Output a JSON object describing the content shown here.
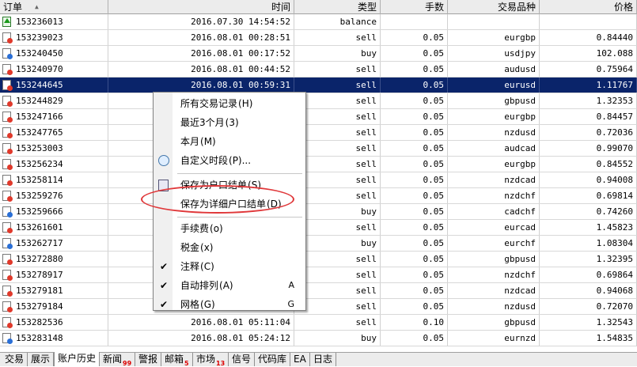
{
  "columns": [
    "订单",
    "时间",
    "类型",
    "手数",
    "交易品种",
    "价格"
  ],
  "rows": [
    {
      "order": "153236013",
      "time": "2016.07.30 14:54:52",
      "type": "balance",
      "lots": "",
      "symbol": "",
      "price": "",
      "icon": "balance"
    },
    {
      "order": "153239023",
      "time": "2016.08.01 00:28:51",
      "type": "sell",
      "lots": "0.05",
      "symbol": "eurgbp",
      "price": "0.84440",
      "icon": "sell"
    },
    {
      "order": "153240450",
      "time": "2016.08.01 00:17:52",
      "type": "buy",
      "lots": "0.05",
      "symbol": "usdjpy",
      "price": "102.088",
      "icon": "buy"
    },
    {
      "order": "153240970",
      "time": "2016.08.01 00:44:52",
      "type": "sell",
      "lots": "0.05",
      "symbol": "audusd",
      "price": "0.75964",
      "icon": "sell"
    },
    {
      "order": "153244645",
      "time": "2016.08.01 00:59:31",
      "type": "sell",
      "lots": "0.05",
      "symbol": "eurusd",
      "price": "1.11767",
      "icon": "sell",
      "selected": true
    },
    {
      "order": "153244829",
      "time": "",
      "type": "sell",
      "lots": "0.05",
      "symbol": "gbpusd",
      "price": "1.32353",
      "icon": "sell"
    },
    {
      "order": "153247166",
      "time": "",
      "type": "sell",
      "lots": "0.05",
      "symbol": "eurgbp",
      "price": "0.84457",
      "icon": "sell"
    },
    {
      "order": "153247765",
      "time": "",
      "type": "sell",
      "lots": "0.05",
      "symbol": "nzdusd",
      "price": "0.72036",
      "icon": "sell"
    },
    {
      "order": "153253003",
      "time": "",
      "type": "sell",
      "lots": "0.05",
      "symbol": "audcad",
      "price": "0.99070",
      "icon": "sell"
    },
    {
      "order": "153256234",
      "time": "",
      "type": "sell",
      "lots": "0.05",
      "symbol": "eurgbp",
      "price": "0.84552",
      "icon": "sell"
    },
    {
      "order": "153258114",
      "time": "",
      "type": "sell",
      "lots": "0.05",
      "symbol": "nzdcad",
      "price": "0.94008",
      "icon": "sell"
    },
    {
      "order": "153259276",
      "time": "",
      "type": "sell",
      "lots": "0.05",
      "symbol": "nzdchf",
      "price": "0.69814",
      "icon": "sell"
    },
    {
      "order": "153259666",
      "time": "",
      "type": "buy",
      "lots": "0.05",
      "symbol": "cadchf",
      "price": "0.74260",
      "icon": "buy"
    },
    {
      "order": "153261601",
      "time": "",
      "type": "sell",
      "lots": "0.05",
      "symbol": "eurcad",
      "price": "1.45823",
      "icon": "sell"
    },
    {
      "order": "153262717",
      "time": "",
      "type": "buy",
      "lots": "0.05",
      "symbol": "eurchf",
      "price": "1.08304",
      "icon": "buy"
    },
    {
      "order": "153272880",
      "time": "",
      "type": "sell",
      "lots": "0.05",
      "symbol": "gbpusd",
      "price": "1.32395",
      "icon": "sell"
    },
    {
      "order": "153278917",
      "time": "",
      "type": "sell",
      "lots": "0.05",
      "symbol": "nzdchf",
      "price": "0.69864",
      "icon": "sell"
    },
    {
      "order": "153279181",
      "time": "",
      "type": "sell",
      "lots": "0.05",
      "symbol": "nzdcad",
      "price": "0.94068",
      "icon": "sell"
    },
    {
      "order": "153279184",
      "time": "",
      "type": "sell",
      "lots": "0.05",
      "symbol": "nzdusd",
      "price": "0.72070",
      "icon": "sell"
    },
    {
      "order": "153282536",
      "time": "2016.08.01 05:11:04",
      "type": "sell",
      "lots": "0.10",
      "symbol": "gbpusd",
      "price": "1.32543",
      "icon": "sell"
    },
    {
      "order": "153283148",
      "time": "2016.08.01 05:24:12",
      "type": "buy",
      "lots": "0.05",
      "symbol": "eurnzd",
      "price": "1.54835",
      "icon": "buy"
    }
  ],
  "context_menu": {
    "items": [
      {
        "label": "所有交易记录",
        "accel": "(H)",
        "icon": ""
      },
      {
        "label": "最近3个月",
        "accel": "(3)",
        "icon": ""
      },
      {
        "label": "本月",
        "accel": "(M)",
        "icon": ""
      },
      {
        "label": "自定义时段",
        "accel": "(P)...",
        "icon": "clock-icon"
      },
      {
        "sep": true
      },
      {
        "label": "保存为户口结单",
        "accel": "(S)",
        "icon": "save-report-icon"
      },
      {
        "label": "保存为详细户口结单",
        "accel": "(D)",
        "icon": "",
        "highlighted": true
      },
      {
        "sep": true
      },
      {
        "label": "手续费",
        "accel": "(o)",
        "icon": ""
      },
      {
        "label": "税金",
        "accel": "(x)",
        "icon": ""
      },
      {
        "label": "注释",
        "accel": "(C)",
        "icon": "",
        "checked": true
      },
      {
        "label": "自动排列",
        "accel": "(A)",
        "key": "A",
        "icon": "",
        "checked": true
      },
      {
        "label": "网格",
        "accel": "(G)",
        "key": "G",
        "icon": "",
        "checked": true
      }
    ]
  },
  "tabs": [
    {
      "label": "交易"
    },
    {
      "label": "展示"
    },
    {
      "label": "账户历史",
      "active": true
    },
    {
      "label": "新闻",
      "badge": "99"
    },
    {
      "label": "警报"
    },
    {
      "label": "邮箱",
      "badge": "5"
    },
    {
      "label": "市场",
      "badge": "13"
    },
    {
      "label": "信号"
    },
    {
      "label": "代码库"
    },
    {
      "label": "EA"
    },
    {
      "label": "日志"
    }
  ],
  "colors": {
    "selection": "#0a246a",
    "highlight_ellipse": "#e0383a",
    "badge": "#dd0000"
  }
}
